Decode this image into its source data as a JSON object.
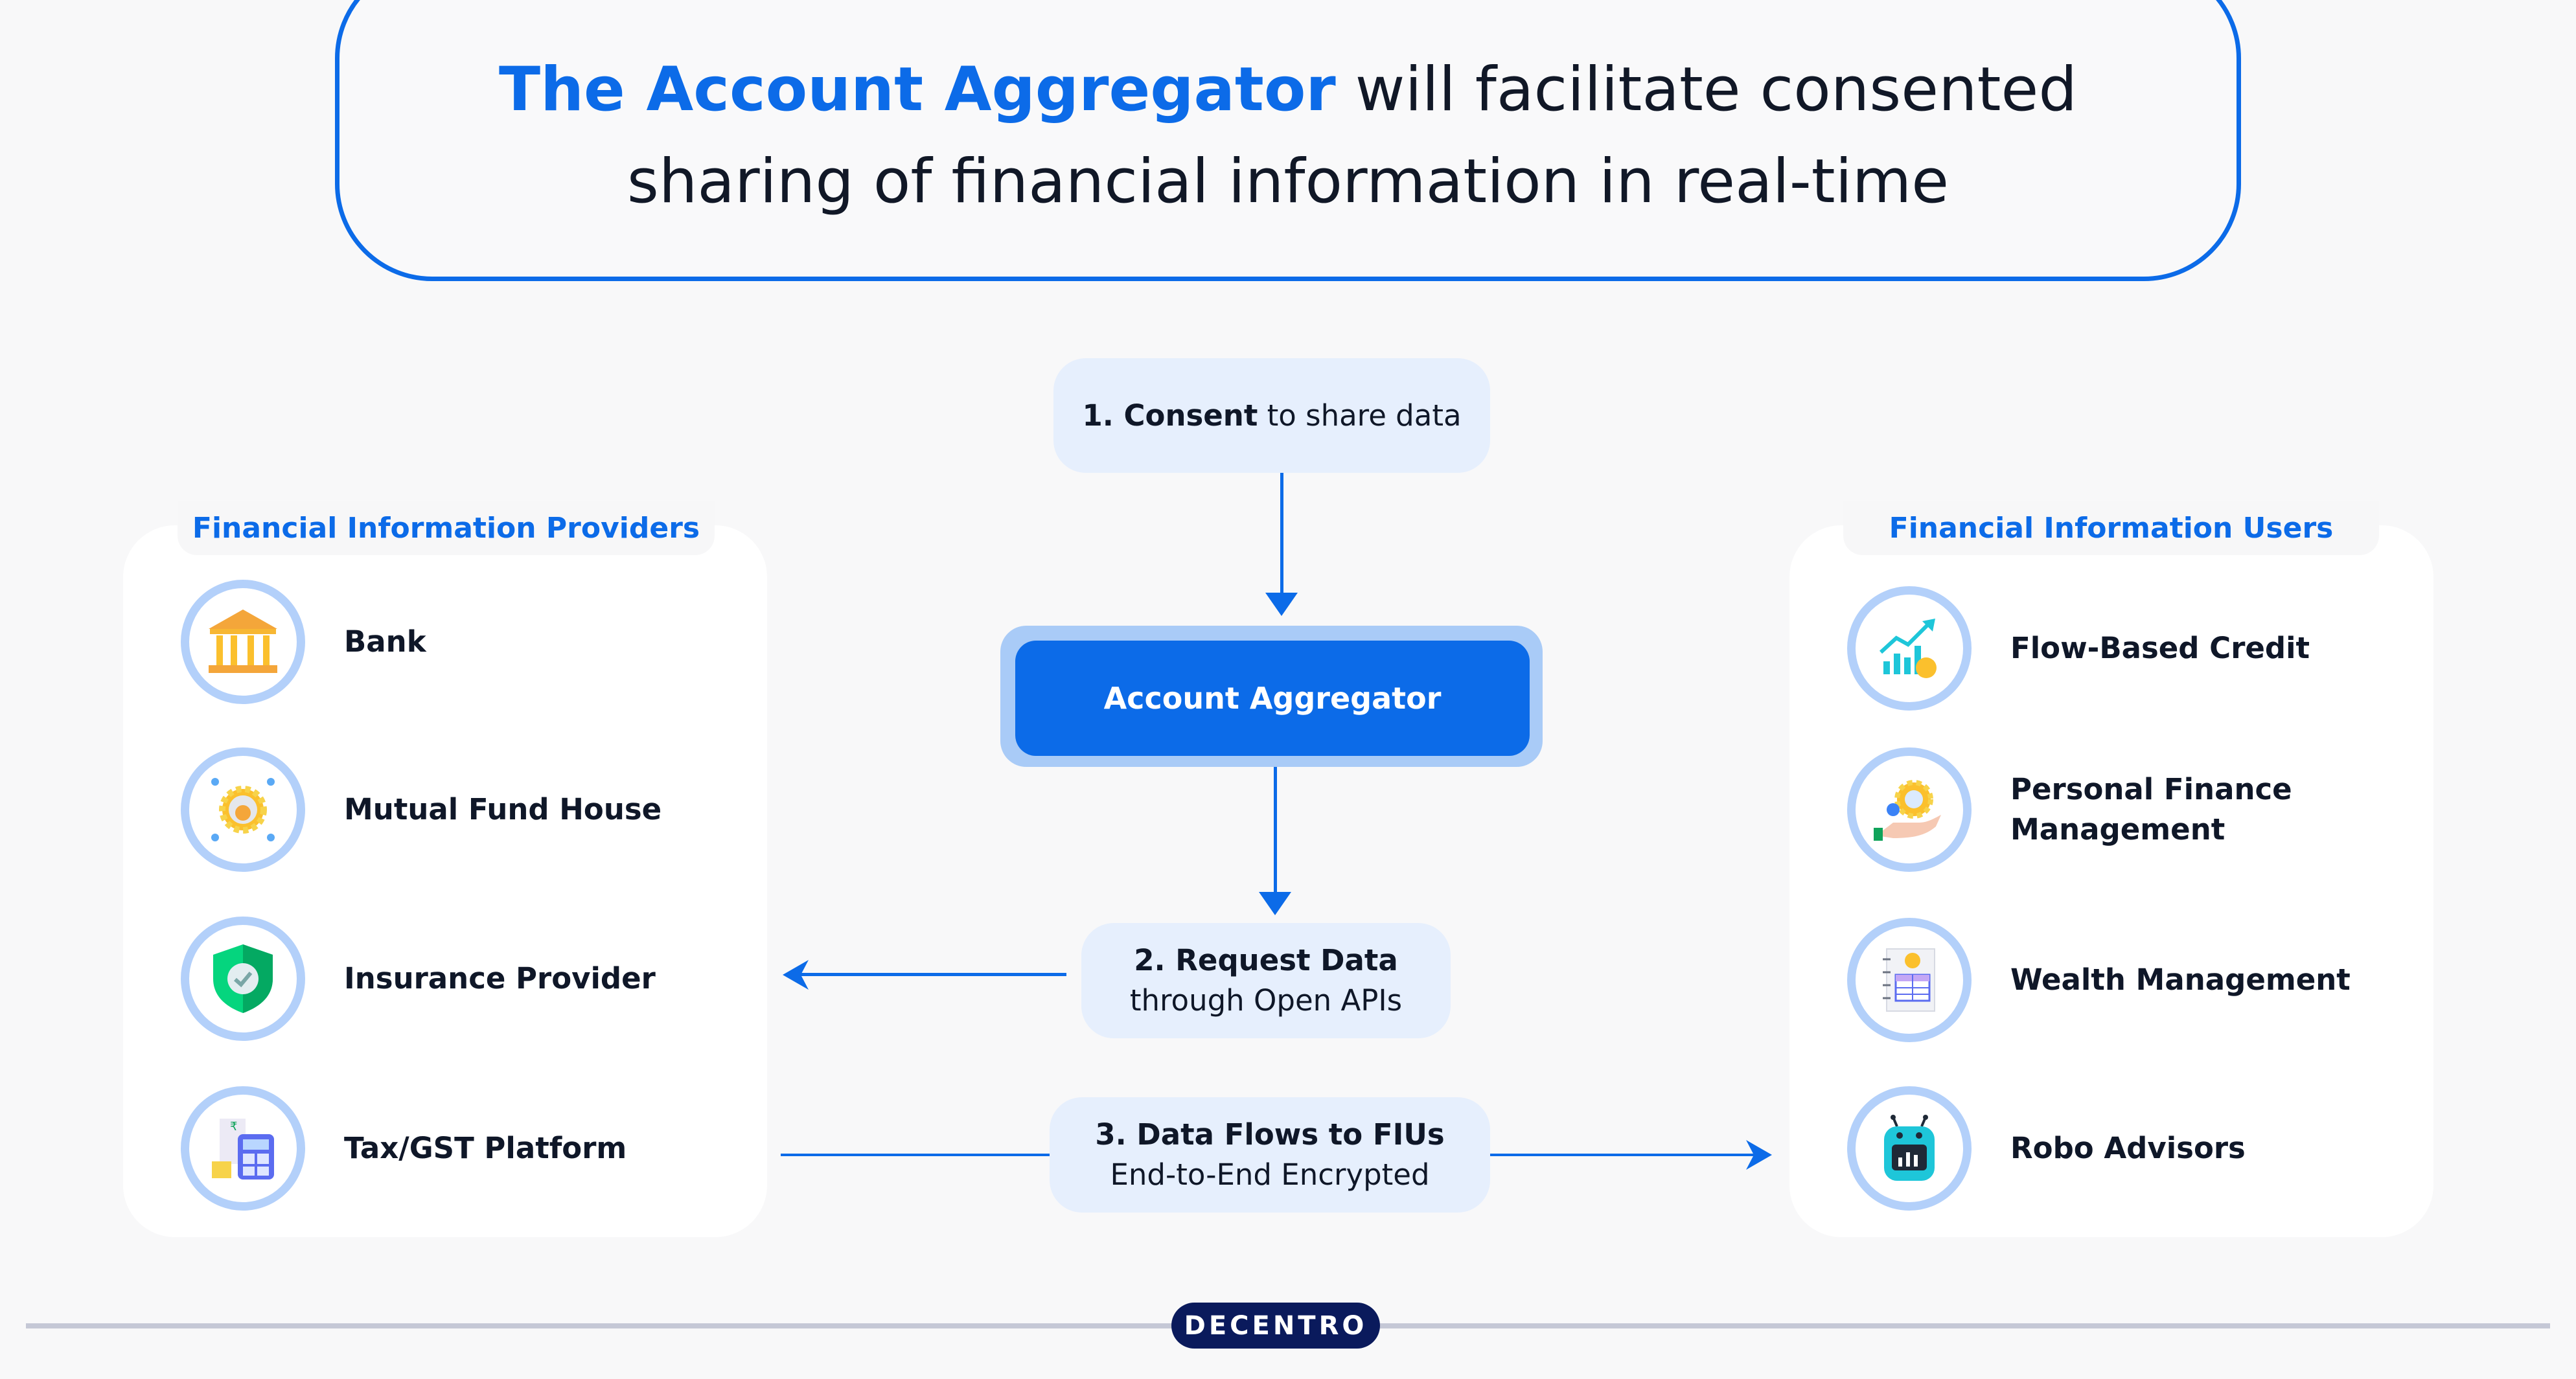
{
  "header": {
    "title_highlight": "The Account Aggregator",
    "title_rest_line1": " will facilitate consented",
    "title_line2": "sharing of financial information in real-time"
  },
  "flow": {
    "step1": {
      "bold": "1. Consent",
      "rest": " to share data"
    },
    "aggregator": "Account Aggregator",
    "step2": {
      "line1": "2. Request Data",
      "line2": "through Open APIs"
    },
    "step3": {
      "line1": "3. Data Flows to FIUs",
      "line2": "End-to-End Encrypted"
    }
  },
  "providers": {
    "title": "Financial Information Providers",
    "items": [
      {
        "label": "Bank",
        "icon": "bank-icon"
      },
      {
        "label": "Mutual Fund House",
        "icon": "mutual-fund-icon"
      },
      {
        "label": "Insurance Provider",
        "icon": "shield-check-icon"
      },
      {
        "label": "Tax/GST Platform",
        "icon": "calculator-icon"
      }
    ]
  },
  "users": {
    "title": "Financial Information Users",
    "items": [
      {
        "label": "Flow-Based Credit",
        "icon": "growth-chart-icon"
      },
      {
        "label": "Personal Finance Management",
        "label_line1": "Personal Finance",
        "label_line2": "Management",
        "icon": "hand-finance-icon"
      },
      {
        "label": "Wealth Management",
        "icon": "ledger-icon"
      },
      {
        "label": "Robo Advisors",
        "icon": "robot-icon"
      }
    ]
  },
  "footer": {
    "brand": "DECENTRO"
  },
  "colors": {
    "accent": "#0c6be8",
    "ring": "#b3d0fa",
    "step_bg": "#e6effd",
    "brand_bg": "#0a1a5c"
  }
}
